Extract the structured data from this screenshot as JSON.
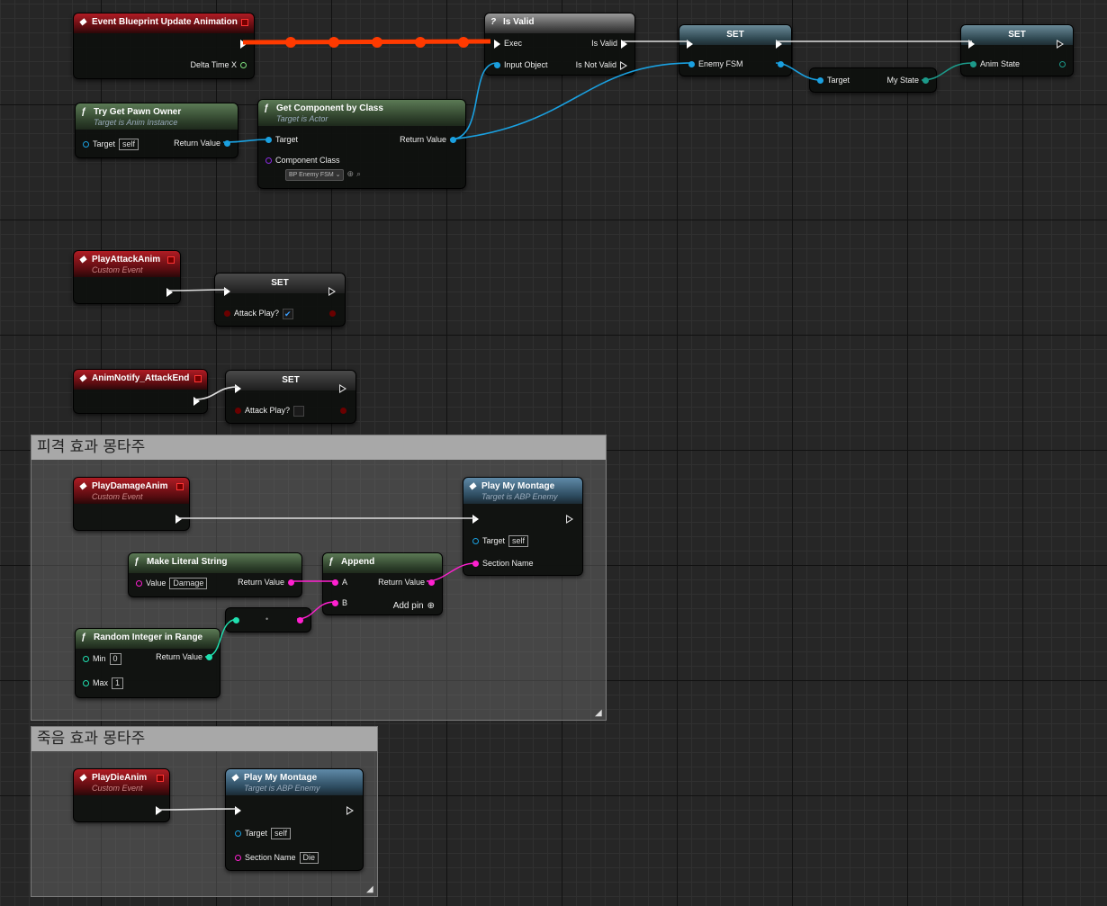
{
  "comments": {
    "damage": {
      "title": "피격 효과 몽타주"
    },
    "die": {
      "title": "죽음 효과 몽타주"
    }
  },
  "nodes": {
    "event_update": {
      "title": "Event Blueprint Update Animation",
      "delta_time": "Delta Time X"
    },
    "is_valid": {
      "title": "Is Valid",
      "icon": "?",
      "exec": "Exec",
      "input_object": "Input Object",
      "is_valid": "Is Valid",
      "is_not_valid": "Is Not Valid"
    },
    "set_enemy_fsm": {
      "title": "SET",
      "enemy_fsm": "Enemy FSM"
    },
    "get_my_state": {
      "target": "Target",
      "my_state": "My State"
    },
    "set_anim_state": {
      "title": "SET",
      "anim_state": "Anim State"
    },
    "try_get_pawn_owner": {
      "title": "Try Get Pawn Owner",
      "subtitle": "Target is Anim Instance",
      "target": "Target",
      "target_value": "self",
      "return_value": "Return Value"
    },
    "get_component_by_class": {
      "title": "Get Component by Class",
      "subtitle": "Target is Actor",
      "target": "Target",
      "return_value": "Return Value",
      "component_class": "Component Class",
      "class_value": "BP Enemy FSM"
    },
    "play_attack_anim": {
      "title": "PlayAttackAnim",
      "subtitle": "Custom Event"
    },
    "set_attack_play_true": {
      "title": "SET",
      "label": "Attack Play?"
    },
    "anim_notify_attack_end": {
      "title": "AnimNotify_AttackEnd"
    },
    "set_attack_play_false": {
      "title": "SET",
      "label": "Attack Play?"
    },
    "play_damage_anim": {
      "title": "PlayDamageAnim",
      "subtitle": "Custom Event"
    },
    "play_my_montage_damage": {
      "title": "Play My Montage",
      "subtitle": "Target is ABP Enemy",
      "target": "Target",
      "target_value": "self",
      "section_name": "Section Name"
    },
    "make_literal_string": {
      "title": "Make Literal String",
      "value_label": "Value",
      "value": "Damage",
      "return_value": "Return Value"
    },
    "append": {
      "title": "Append",
      "a": "A",
      "b": "B",
      "return_value": "Return Value",
      "add_pin": "Add pin"
    },
    "random_int": {
      "title": "Random Integer in Range",
      "min": "Min",
      "min_value": "0",
      "max": "Max",
      "max_value": "1",
      "return_value": "Return Value"
    },
    "play_die_anim": {
      "title": "PlayDieAnim",
      "subtitle": "Custom Event"
    },
    "play_my_montage_die": {
      "title": "Play My Montage",
      "subtitle": "Target is ABP Enemy",
      "target": "Target",
      "target_value": "self",
      "section_name": "Section Name",
      "section_value": "Die"
    }
  },
  "colors": {
    "event_header": "#b01c24",
    "function_header": "#5b7a55",
    "object_pin": "#1aa0e0",
    "string_pin": "#ff20d0",
    "int_pin": "#20e0b0",
    "exec_wire": "#ffffff",
    "active_exec_wire": "#ff3a00"
  }
}
